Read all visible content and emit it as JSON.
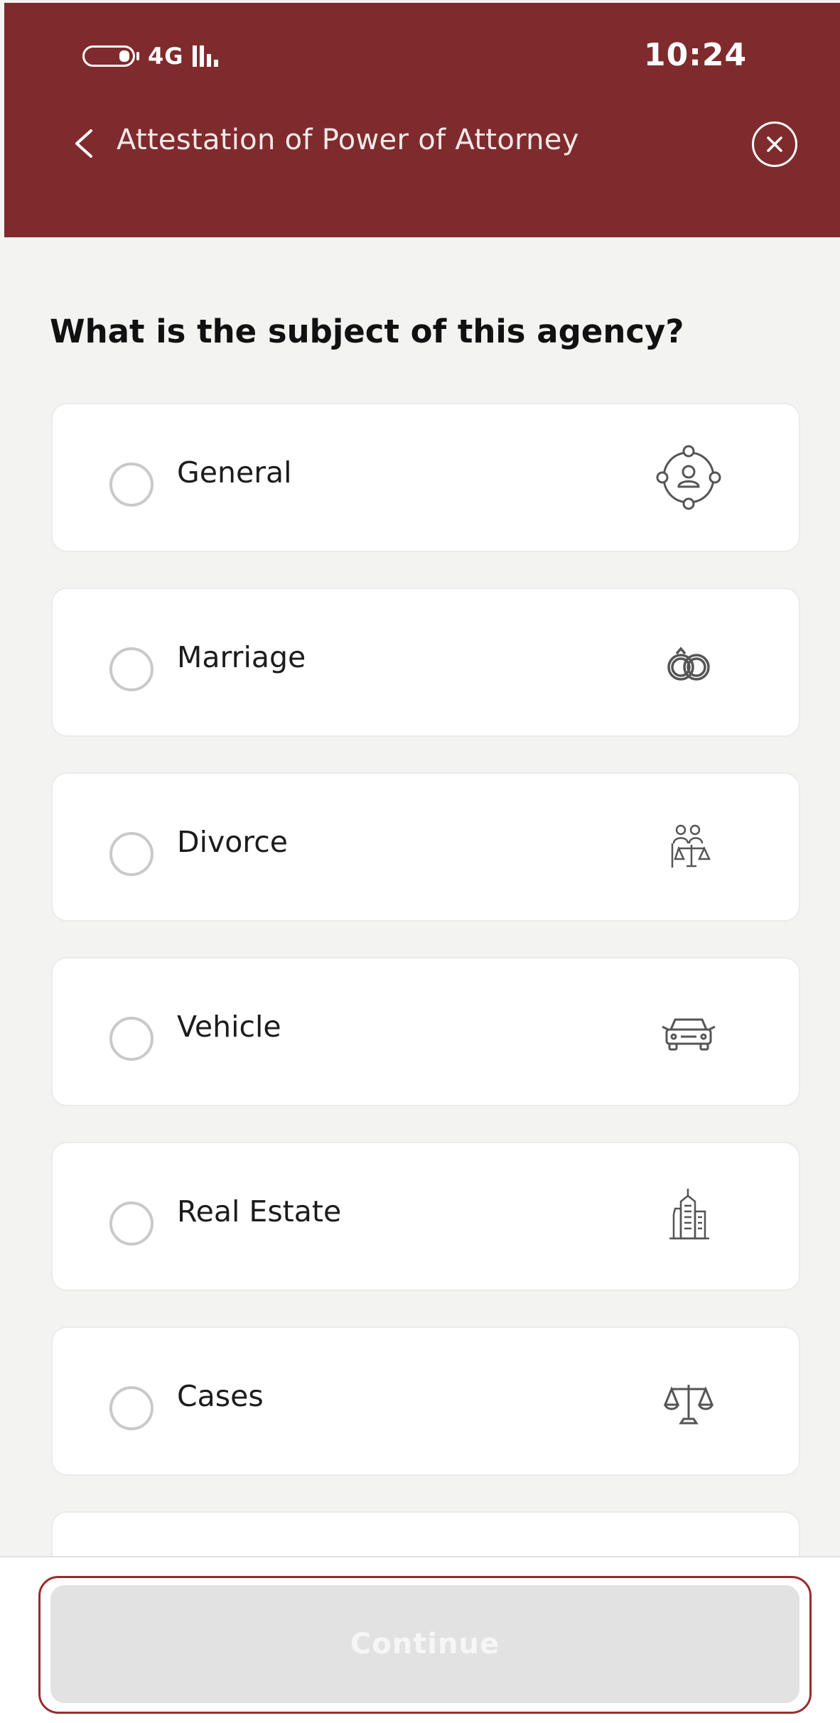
{
  "status_bar": {
    "network": "4G",
    "time": "10:24"
  },
  "header": {
    "title": "Attestation of Power of Attorney"
  },
  "question": "What is the subject of this agency?",
  "options": [
    {
      "label": "General",
      "icon": "person-network-icon"
    },
    {
      "label": "Marriage",
      "icon": "rings-icon"
    },
    {
      "label": "Divorce",
      "icon": "divorce-scales-icon"
    },
    {
      "label": "Vehicle",
      "icon": "car-icon"
    },
    {
      "label": "Real Estate",
      "icon": "building-icon"
    },
    {
      "label": "Cases",
      "icon": "scales-icon"
    }
  ],
  "continue_label": "Continue",
  "colors": {
    "brand": "#7f2b2d",
    "background": "#f3f3f2",
    "disabled_button": "#e2e2e2"
  }
}
